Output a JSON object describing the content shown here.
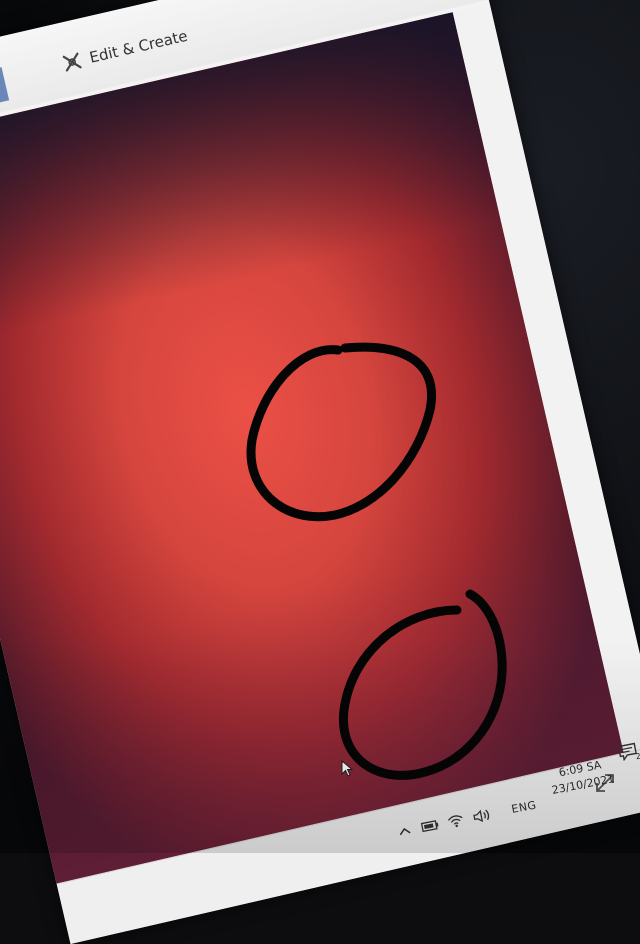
{
  "window": {
    "edit_create_label": "Edit & Create",
    "edit_create_icon": "edit-create-icon"
  },
  "image": {
    "dominant_color": "#d94a42",
    "annotation_color": "#000000"
  },
  "taskbar": {
    "language": "ENG",
    "time": "6:09 SA",
    "date": "23/10/2021",
    "notification_count": "2"
  },
  "icons": {
    "chevron": "chevron-up-icon",
    "battery": "battery-icon",
    "wifi": "wifi-icon",
    "volume": "volume-icon",
    "notification": "notification-icon",
    "expand": "expand-icon",
    "cursor": "mouse-cursor-icon"
  }
}
